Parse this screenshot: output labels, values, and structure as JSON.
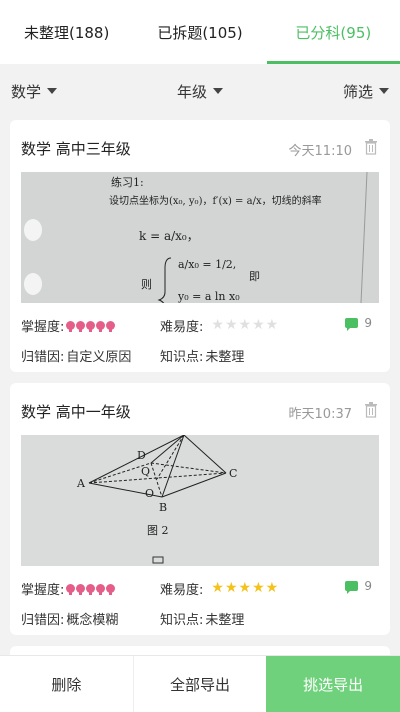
{
  "tabs": [
    {
      "label": "未整理(188)",
      "active": false
    },
    {
      "label": "已拆题(105)",
      "active": false
    },
    {
      "label": "已分科(95)",
      "active": true
    }
  ],
  "filters": {
    "subject": "数学",
    "grade": "年级",
    "filter": "筛选"
  },
  "cards": [
    {
      "title": "数学  高中三年级",
      "time": "今天11:10",
      "mastery_label": "掌握度:",
      "difficulty_label": "难易度:",
      "difficulty_stars": 0,
      "comment_count": "9",
      "error_cause_label": "归错因:",
      "error_cause": "自定义原因",
      "knowledge_label": "知识点:",
      "knowledge": "未整理",
      "photo_text": {
        "line1": "练习1:",
        "line2": "设切点坐标为(x₀, y₀)，f′(x) = a/x，切线的斜率",
        "line3": "k = a/x₀，",
        "line4": "则",
        "line5": "即"
      }
    },
    {
      "title": "数学  高中一年级",
      "time": "昨天10:37",
      "mastery_label": "掌握度:",
      "difficulty_label": "难易度:",
      "difficulty_stars": 5,
      "comment_count": "9",
      "error_cause_label": "归错因:",
      "error_cause": "概念模糊",
      "knowledge_label": "知识点:",
      "knowledge": "未整理",
      "photo_text": {
        "fig": "图 2"
      }
    }
  ],
  "bottom": {
    "delete": "删除",
    "export_all": "全部导出",
    "export_selected": "挑选导出"
  },
  "colors": {
    "accent": "#4cbf63",
    "mastery_dot": "#e55e8a",
    "star_on": "#f4c21a",
    "star_off": "#e0e0e0"
  }
}
